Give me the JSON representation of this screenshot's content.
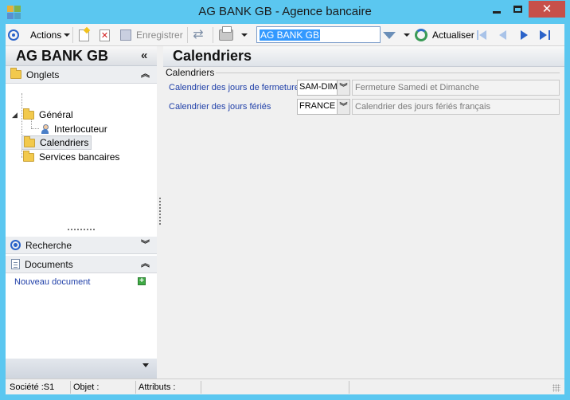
{
  "window": {
    "title": "AG BANK GB -  Agence bancaire",
    "min_label": "",
    "close_label": "✕"
  },
  "toolbar": {
    "actions_label": "Actions",
    "save_label": "Enregistrer",
    "search_value": "AG BANK GB",
    "refresh_label": "Actualiser"
  },
  "left_panel": {
    "title": "AG BANK GB",
    "collapse_glyph": "«",
    "sections": {
      "onglets": {
        "label": "Onglets",
        "chevron": "︽"
      },
      "recherche": {
        "label": "Recherche",
        "chevron": "︾"
      },
      "documents": {
        "label": "Documents",
        "chevron": "︽"
      }
    },
    "tree": [
      {
        "label": "Général"
      },
      {
        "label": "Interlocuteur"
      },
      {
        "label": "Calendriers"
      },
      {
        "label": "Services bancaires"
      }
    ],
    "new_document_link": "Nouveau document",
    "add_glyph": "+"
  },
  "main": {
    "title": "Calendriers",
    "group_title": "Calendriers",
    "fields": [
      {
        "label": "Calendrier des jours de fermeture",
        "value": "SAM-DIM",
        "description": "Fermeture Samedi et  Dimanche"
      },
      {
        "label": "Calendrier des jours fériés",
        "value": "FRANCE",
        "description": "Calendrier des jours fériés français"
      }
    ],
    "dropdown_glyph": "︾"
  },
  "status_bar": {
    "societe": "Société :S1",
    "objet": "Objet :",
    "attributs": "Attributs :"
  },
  "colors": {
    "titlebar": "#5bc7f0",
    "close_button": "#c7504a",
    "accent_blue": "#2b63c9",
    "link_blue": "#1f3fa8"
  }
}
